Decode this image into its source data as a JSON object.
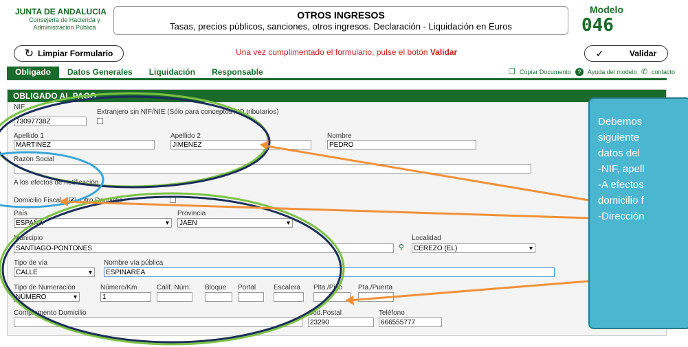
{
  "header": {
    "org": "JUNTA DE ANDALUCIA",
    "dept_line1": "Consejería de Hacienda y",
    "dept_line2": "Administración Pública",
    "title": "OTROS INGRESOS",
    "subtitle": "Tasas, precios públicos, sanciones, otros ingresos. Declaración - Liquidación en Euros",
    "modelo_label": "Modelo",
    "modelo_number": "046"
  },
  "toolbar": {
    "clear_label": "Limpiar Formulario",
    "notice_text": "Una vez cumplimentado el formulario, pulse el botón",
    "notice_bold": "Validar",
    "validate_label": "Validar"
  },
  "nav": {
    "tabs": [
      "Obligado",
      "Datos Generales",
      "Liquidación",
      "Responsable"
    ],
    "copy_doc": "Copiar Documento",
    "help": "Ayuda del modelo",
    "contact": "contacto"
  },
  "section": {
    "title": "OBLIGADO AL PAGO"
  },
  "form": {
    "nif_label": "NIF",
    "nif_value": "73097738Z",
    "extranjero_label": "Extranjero sin NIF/NIE (Sólo para conceptos NO tributarios)",
    "apellido1_label": "Apellido 1",
    "apellido1_value": "MARTINEZ",
    "apellido2_label": "Apellido 2",
    "apellido2_value": "JIMENEZ",
    "nombre_label": "Nombre",
    "nombre_value": "PEDRO",
    "razon_label": "Razón Social",
    "notif_label": "A los efectos de notificación",
    "domicilio_fiscal_label": "Domicilio Fiscal",
    "otro_domicilio_label": "Otro Domicilio",
    "pais_label": "País",
    "pais_value": "ESPAÑA",
    "provincia_label": "Provincia",
    "provincia_value": "JAEN",
    "municipio_label": "Municipio",
    "municipio_value": "SANTIAGO-PONTONES",
    "localidad_label": "Localidad",
    "localidad_value": "CEREZO (EL)",
    "tipo_via_label": "Tipo de vía",
    "tipo_via_value": "CALLE",
    "nombre_via_label": "Nombre vía pública",
    "nombre_via_value": "ESPINAREA",
    "tipo_num_label": "Tipo de Numeración",
    "tipo_num_value": "NÚMERO",
    "numero_label": "Número/Km",
    "numero_value": "1",
    "calif_label": "Calif. Núm.",
    "bloque_label": "Bloque",
    "portal_label": "Portal",
    "escalera_label": "Escalera",
    "planta_label": "Plta./Piso",
    "puerta_label": "Pta./Puerta",
    "complemento_label": "Complemento Domicilio",
    "cp_label": "Cód.Postal",
    "cp_value": "23290",
    "telefono_label": "Teléfono",
    "telefono_value": "666555777"
  },
  "callout": {
    "lines": [
      "Debemos",
      "siguiente",
      "datos del",
      "-NIF, apell",
      "-A efectos",
      "domicilio f",
      "-Dirección"
    ]
  },
  "colors": {
    "brand_green": "#1a6b2b",
    "ellipse_green": "#7bc144",
    "ellipse_navy": "#1b2e5a",
    "ellipse_blue": "#3aa6d8",
    "arrow_orange": "#f0913a",
    "callout_fill": "#4ab6d0"
  }
}
